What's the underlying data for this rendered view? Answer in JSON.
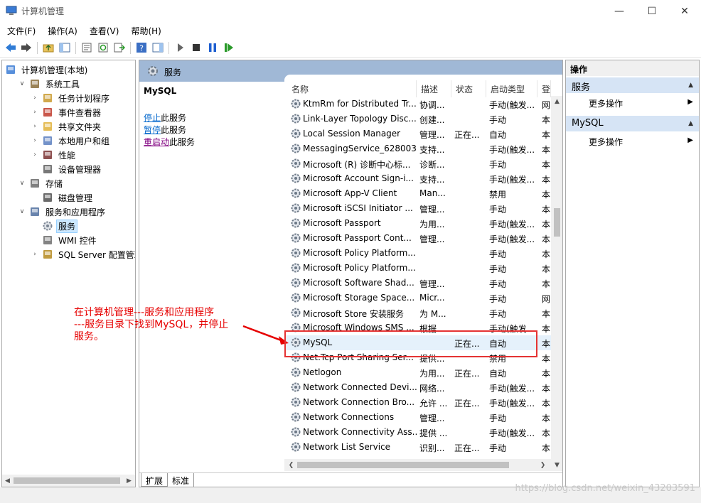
{
  "window": {
    "title": "计算机管理"
  },
  "menu": [
    "文件(F)",
    "操作(A)",
    "查看(V)",
    "帮助(H)"
  ],
  "tree": [
    {
      "label": "计算机管理(本地)",
      "level": 0,
      "expander": "",
      "icon": "computer-icon"
    },
    {
      "label": "系统工具",
      "level": 1,
      "expander": "v",
      "icon": "tools-icon"
    },
    {
      "label": "任务计划程序",
      "level": 2,
      "expander": ">",
      "icon": "clock-icon"
    },
    {
      "label": "事件查看器",
      "level": 2,
      "expander": ">",
      "icon": "event-icon"
    },
    {
      "label": "共享文件夹",
      "level": 2,
      "expander": ">",
      "icon": "share-folder-icon"
    },
    {
      "label": "本地用户和组",
      "level": 2,
      "expander": ">",
      "icon": "users-icon"
    },
    {
      "label": "性能",
      "level": 2,
      "expander": ">",
      "icon": "performance-icon"
    },
    {
      "label": "设备管理器",
      "level": 2,
      "expander": "",
      "icon": "device-manager-icon"
    },
    {
      "label": "存储",
      "level": 1,
      "expander": "v",
      "icon": "storage-icon"
    },
    {
      "label": "磁盘管理",
      "level": 2,
      "expander": "",
      "icon": "disk-icon"
    },
    {
      "label": "服务和应用程序",
      "level": 1,
      "expander": "v",
      "icon": "services-apps-icon"
    },
    {
      "label": "服务",
      "level": 2,
      "expander": "",
      "icon": "gear-icon",
      "selected": true
    },
    {
      "label": "WMI 控件",
      "level": 2,
      "expander": "",
      "icon": "wmi-icon"
    },
    {
      "label": "SQL Server 配置管理器",
      "level": 2,
      "expander": ">",
      "icon": "sql-icon"
    }
  ],
  "middle": {
    "header_title": "服务",
    "selected_service": "MySQL",
    "links": [
      {
        "link": "停止",
        "suffix": "此服务"
      },
      {
        "link": "暂停",
        "suffix": "此服务"
      },
      {
        "link": "重启动",
        "suffix": "此服务"
      }
    ],
    "columns": [
      "名称",
      "描述",
      "状态",
      "启动类型",
      "登"
    ],
    "services": [
      {
        "name": "KtmRm for Distributed Tr...",
        "desc": "协调...",
        "status": "",
        "startup": "手动(触发...",
        "logon": "网"
      },
      {
        "name": "Link-Layer Topology Disc...",
        "desc": "创建...",
        "status": "",
        "startup": "手动",
        "logon": "本"
      },
      {
        "name": "Local Session Manager",
        "desc": "管理...",
        "status": "正在...",
        "startup": "自动",
        "logon": "本"
      },
      {
        "name": "MessagingService_628003",
        "desc": "支持...",
        "status": "",
        "startup": "手动(触发...",
        "logon": "本"
      },
      {
        "name": "Microsoft (R) 诊断中心标...",
        "desc": "诊断...",
        "status": "",
        "startup": "手动",
        "logon": "本"
      },
      {
        "name": "Microsoft Account Sign-i...",
        "desc": "支持...",
        "status": "",
        "startup": "手动(触发...",
        "logon": "本"
      },
      {
        "name": "Microsoft App-V Client",
        "desc": "Man...",
        "status": "",
        "startup": "禁用",
        "logon": "本"
      },
      {
        "name": "Microsoft iSCSI Initiator ...",
        "desc": "管理...",
        "status": "",
        "startup": "手动",
        "logon": "本"
      },
      {
        "name": "Microsoft Passport",
        "desc": "为用...",
        "status": "",
        "startup": "手动(触发...",
        "logon": "本"
      },
      {
        "name": "Microsoft Passport Cont...",
        "desc": "管理...",
        "status": "",
        "startup": "手动(触发...",
        "logon": "本"
      },
      {
        "name": "Microsoft Policy Platform...",
        "desc": "",
        "status": "",
        "startup": "手动",
        "logon": "本"
      },
      {
        "name": "Microsoft Policy Platform...",
        "desc": "",
        "status": "",
        "startup": "手动",
        "logon": "本"
      },
      {
        "name": "Microsoft Software Shad...",
        "desc": "管理...",
        "status": "",
        "startup": "手动",
        "logon": "本"
      },
      {
        "name": "Microsoft Storage Space...",
        "desc": "Micr...",
        "status": "",
        "startup": "手动",
        "logon": "网"
      },
      {
        "name": "Microsoft Store 安装服务",
        "desc": "为 M...",
        "status": "",
        "startup": "手动",
        "logon": "本"
      },
      {
        "name": "Microsoft Windows SMS ...",
        "desc": "根据...",
        "status": "",
        "startup": "手动(触发...",
        "logon": "本"
      },
      {
        "name": "MySQL",
        "desc": "",
        "status": "正在...",
        "startup": "自动",
        "logon": "本",
        "selected": true
      },
      {
        "name": "Net.Tcp Port Sharing Ser...",
        "desc": "提供...",
        "status": "",
        "startup": "禁用",
        "logon": "本"
      },
      {
        "name": "Netlogon",
        "desc": "为用...",
        "status": "正在...",
        "startup": "自动",
        "logon": "本"
      },
      {
        "name": "Network Connected Devi...",
        "desc": "网络...",
        "status": "",
        "startup": "手动(触发...",
        "logon": "本"
      },
      {
        "name": "Network Connection Bro...",
        "desc": "允许 ...",
        "status": "正在...",
        "startup": "手动(触发...",
        "logon": "本"
      },
      {
        "name": "Network Connections",
        "desc": "管理...",
        "status": "",
        "startup": "手动",
        "logon": "本"
      },
      {
        "name": "Network Connectivity Ass...",
        "desc": "提供 ...",
        "status": "",
        "startup": "手动(触发...",
        "logon": "本"
      },
      {
        "name": "Network List Service",
        "desc": "识别...",
        "status": "正在...",
        "startup": "手动",
        "logon": "本"
      }
    ],
    "tabs": [
      "扩展",
      "标准"
    ]
  },
  "actions": {
    "title": "操作",
    "sections": [
      {
        "title": "服务",
        "item": "更多操作"
      },
      {
        "title": "MySQL",
        "item": "更多操作"
      }
    ]
  },
  "annotation": "在计算机管理---服务和应用程序\n---服务目录下找到MySQL，并停止\n服务。",
  "watermark": "https://blog.csdn.net/weixin_43203591",
  "colors": {
    "accent": "#0066cc",
    "annotation": "#e60000",
    "header": "#a0b8d6",
    "selection": "#cce8ff"
  }
}
